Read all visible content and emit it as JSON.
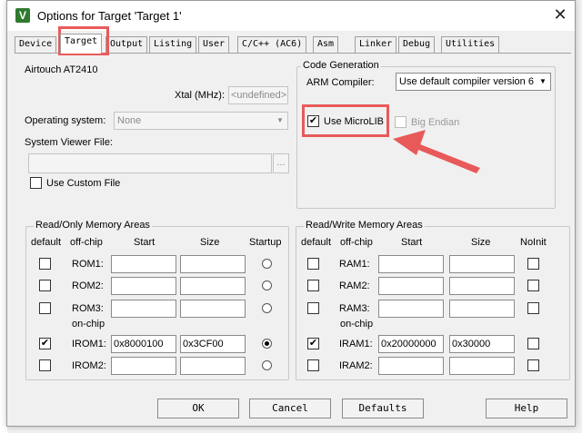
{
  "window": {
    "title": "Options for Target 'Target 1'",
    "close_glyph": "✕",
    "app_icon_letter": "V"
  },
  "tabs": [
    "Device",
    "Target",
    "Output",
    "Listing",
    "User",
    "C/C++ (AC6)",
    "Asm",
    "Linker",
    "Debug",
    "Utilities"
  ],
  "active_tab": "Target",
  "target": {
    "device_name": "Airtouch AT2410",
    "xtal_label": "Xtal (MHz):",
    "xtal_value": "<undefined>",
    "os_label": "Operating system:",
    "os_value": "None",
    "svf_label": "System Viewer File:",
    "svf_value": "",
    "svf_browse": "...",
    "custom_file_label": "Use Custom File"
  },
  "codegen": {
    "title": "Code Generation",
    "compiler_label": "ARM Compiler:",
    "compiler_value": "Use default compiler version 6",
    "microlib_label": "Use MicroLIB",
    "microlib_checked": true,
    "big_endian_label": "Big Endian"
  },
  "ro": {
    "title": "Read/Only Memory Areas",
    "headers": {
      "default": "default",
      "offchip": "off-chip",
      "start": "Start",
      "size": "Size",
      "startup": "Startup"
    },
    "onchip_label": "on-chip",
    "rows": [
      {
        "name": "ROM1:",
        "start": "",
        "size": "",
        "default": false,
        "startup": false
      },
      {
        "name": "ROM2:",
        "start": "",
        "size": "",
        "default": false,
        "startup": false
      },
      {
        "name": "ROM3:",
        "start": "",
        "size": "",
        "default": false,
        "startup": false
      },
      {
        "name": "IROM1:",
        "start": "0x8000100",
        "size": "0x3CF00",
        "default": true,
        "startup": true
      },
      {
        "name": "IROM2:",
        "start": "",
        "size": "",
        "default": false,
        "startup": false
      }
    ]
  },
  "rw": {
    "title": "Read/Write Memory Areas",
    "headers": {
      "default": "default",
      "offchip": "off-chip",
      "start": "Start",
      "size": "Size",
      "noinit": "NoInit"
    },
    "onchip_label": "on-chip",
    "rows": [
      {
        "name": "RAM1:",
        "start": "",
        "size": "",
        "default": false,
        "noinit": false
      },
      {
        "name": "RAM2:",
        "start": "",
        "size": "",
        "default": false,
        "noinit": false
      },
      {
        "name": "RAM3:",
        "start": "",
        "size": "",
        "default": false,
        "noinit": false
      },
      {
        "name": "IRAM1:",
        "start": "0x20000000",
        "size": "0x30000",
        "default": true,
        "noinit": false
      },
      {
        "name": "IRAM2:",
        "start": "",
        "size": "",
        "default": false,
        "noinit": false
      }
    ]
  },
  "buttons": {
    "ok": "OK",
    "cancel": "Cancel",
    "defaults": "Defaults",
    "help": "Help"
  },
  "annotation_color": "#e85a5a",
  "check_glyph": "✔"
}
